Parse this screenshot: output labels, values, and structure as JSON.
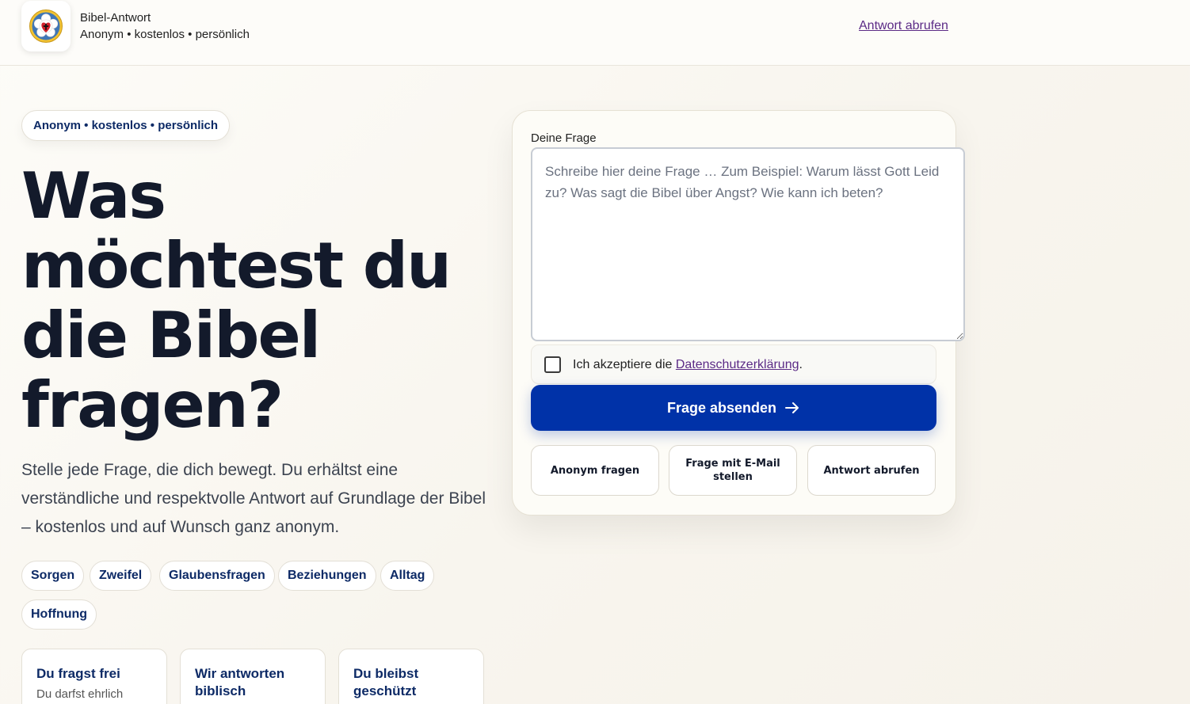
{
  "header": {
    "brand_title": "Bibel-Antwort",
    "brand_subtitle": "Anonym • kostenlos • persönlich",
    "link": "Antwort abrufen",
    "logo_icon": "luther-rose-icon"
  },
  "hero": {
    "pill": "Anonym • kostenlos • persönlich",
    "headline": [
      "Was",
      "möchtest du",
      "die Bibel",
      "fragen?"
    ],
    "lead": "Stelle jede Frage, die dich bewegt. Du erhältst eine verständliche und respektvolle Antwort auf Grundlage der Bibel – kostenlos und auf Wunsch ganz anonym.",
    "tags": [
      "Sorgen",
      "Zweifel",
      "Glaubensfragen",
      "Beziehungen",
      "Alltag",
      "Hoffnung"
    ]
  },
  "features": [
    {
      "title": "Du fragst frei",
      "text": "Du darfst ehrlich"
    },
    {
      "title": "Wir antworten biblisch",
      "text": ""
    },
    {
      "title": "Du bleibst geschützt",
      "text": ""
    }
  ],
  "form": {
    "label": "Deine Frage",
    "placeholder": "Schreibe hier deine Frage … Zum Beispiel: Warum lässt Gott Leid zu? Was sagt die Bibel über Angst? Wie kann ich beten?",
    "consent_prefix": "Ich akzeptiere die ",
    "consent_link": "Datenschutzerklärung",
    "consent_suffix": ".",
    "submit_label": "Frage absenden",
    "options": [
      "Anonym fragen",
      "Frage mit E-Mail stellen",
      "Antwort abrufen"
    ]
  },
  "colors": {
    "primary": "#0032a8",
    "navy_text": "#0d2a66",
    "link": "#5b2a86",
    "background": "#f8f5ee"
  }
}
